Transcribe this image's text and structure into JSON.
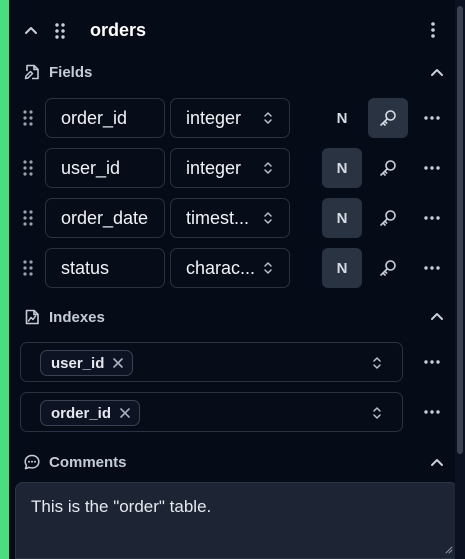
{
  "table": {
    "name": "orders"
  },
  "sections": {
    "fields_label": "Fields",
    "indexes_label": "Indexes",
    "comments_label": "Comments"
  },
  "fields": [
    {
      "name": "order_id",
      "type": "integer",
      "nullable_label": "N",
      "nullable_active": false,
      "primary_key": true
    },
    {
      "name": "user_id",
      "type": "integer",
      "nullable_label": "N",
      "nullable_active": true,
      "primary_key": false
    },
    {
      "name": "order_date",
      "type": "timest...",
      "nullable_label": "N",
      "nullable_active": true,
      "primary_key": false
    },
    {
      "name": "status",
      "type": "charac...",
      "nullable_label": "N",
      "nullable_active": true,
      "primary_key": false
    }
  ],
  "indexes": [
    {
      "column": "user_id"
    },
    {
      "column": "order_id"
    }
  ],
  "comment": {
    "text": "This is the \"order\" table."
  },
  "colors": {
    "accent": "#4ade80",
    "background": "#060b18",
    "active_button": "#2a3342"
  },
  "icons": {
    "collapse": "chevron-up-icon",
    "drag": "drag-handle-icon",
    "menu": "vertical-dots-icon",
    "fields": "file-edit-icon",
    "indexes": "file-chart-icon",
    "comments": "message-circle-icon",
    "key": "key-icon",
    "more": "horizontal-dots-icon",
    "select": "chevron-up-down-icon",
    "remove": "x-icon"
  }
}
